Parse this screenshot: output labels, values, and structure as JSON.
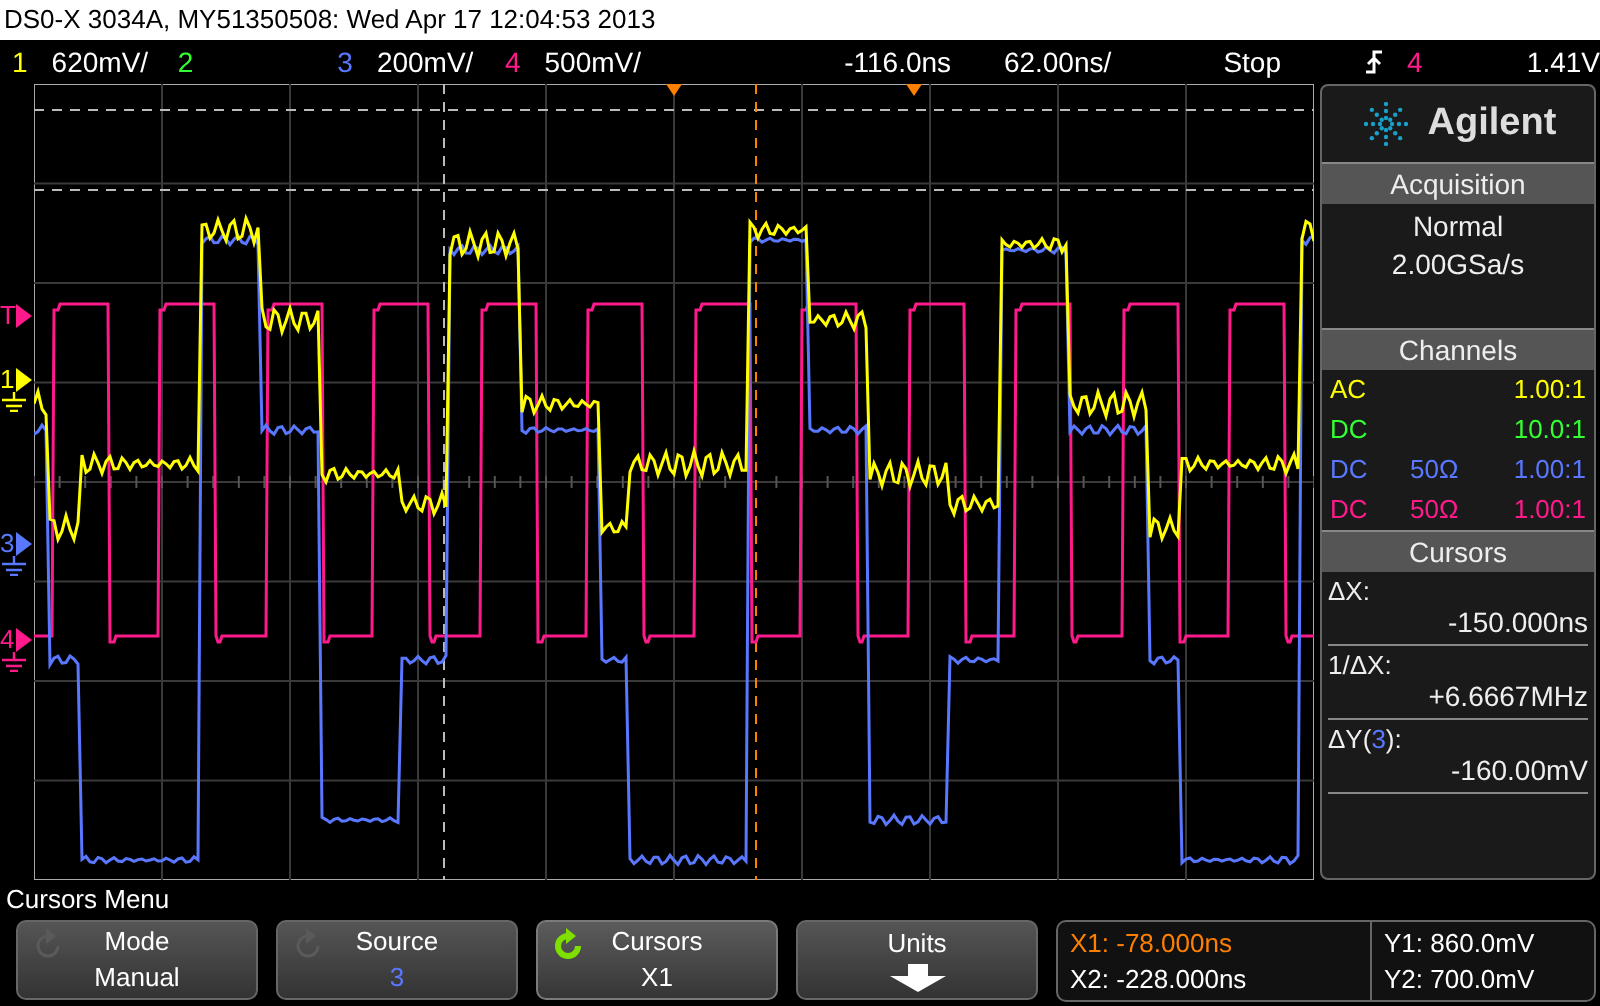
{
  "window": {
    "title": "DS0-X 3034A, MY51350508: Wed Apr 17 12:04:53 2013"
  },
  "status_bar": {
    "channels": [
      {
        "number": "1",
        "scale": "620mV/",
        "color": "#ffff00"
      },
      {
        "number": "2",
        "color": "#33ff33"
      },
      {
        "number": "3",
        "scale": "200mV/",
        "color": "#5a78ff"
      },
      {
        "number": "4",
        "scale": "500mV/",
        "color": "#ff1a8c"
      }
    ],
    "delay": "-116.0ns",
    "timebase": "62.00ns/",
    "run_state": "Stop",
    "trigger": {
      "source": "4",
      "level": "1.41V",
      "color": "#ff1a8c"
    }
  },
  "markers": [
    {
      "label": "T",
      "kind": "trigger",
      "color": "#ff1a8c"
    },
    {
      "label": "1",
      "kind": "ground",
      "color": "#ffff00"
    },
    {
      "label": "3",
      "kind": "ground",
      "color": "#5a78ff"
    },
    {
      "label": "4",
      "kind": "ground",
      "color": "#ff1a8c"
    }
  ],
  "panel": {
    "brand": "Agilent",
    "acquisition": {
      "title": "Acquisition",
      "mode": "Normal",
      "rate": "2.00GSa/s"
    },
    "channels": {
      "title": "Channels",
      "rows": [
        {
          "coupling": "AC",
          "probe": "1.00:1",
          "color": "#ffff00"
        },
        {
          "coupling": "DC",
          "probe": "10.0:1",
          "color": "#33ff33"
        },
        {
          "coupling": "DC",
          "impedance": "50Ω",
          "probe": "1.00:1",
          "color": "#5a78ff"
        },
        {
          "coupling": "DC",
          "impedance": "50Ω",
          "probe": "1.00:1",
          "color": "#ff1a8c"
        }
      ]
    },
    "cursors": {
      "title": "Cursors",
      "rows": [
        {
          "label": "ΔX:",
          "value": "-150.000ns"
        },
        {
          "label": "1/ΔX:",
          "value": "+6.6667MHz"
        },
        {
          "label": "ΔY(",
          "source": {
            "text": "3",
            "color": "#5a78ff"
          },
          "suffix": "):",
          "value": "-160.00mV"
        }
      ]
    }
  },
  "menu_title": "Cursors Menu",
  "softkeys": [
    {
      "kind": "text",
      "title": "Mode",
      "value": {
        "text": "Manual",
        "color": "#ffffff"
      },
      "active": false
    },
    {
      "kind": "text",
      "title": "Source",
      "value": {
        "text": "3",
        "color": "#5a78ff"
      },
      "active": false
    },
    {
      "kind": "text",
      "title": "Cursors",
      "value": {
        "text": "X1",
        "color": "#ffffff"
      },
      "active": true
    },
    {
      "kind": "arrow",
      "title": "Units"
    }
  ],
  "readouts": {
    "x": [
      {
        "text": "X1: -78.000ns",
        "selected": true
      },
      {
        "text": "X2: -228.000ns",
        "selected": false
      }
    ],
    "y": [
      {
        "text": "Y1: 860.0mV"
      },
      {
        "text": "Y2: 700.0mV"
      }
    ]
  }
}
